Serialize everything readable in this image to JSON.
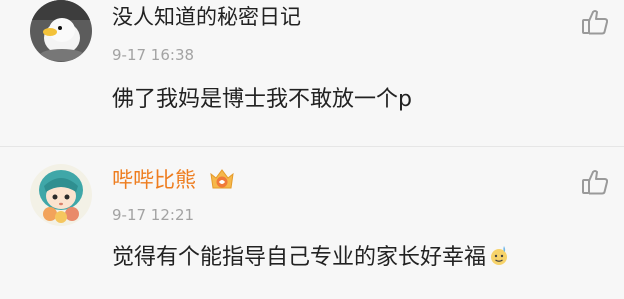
{
  "comments": [
    {
      "username": "没人知道的秘密日记",
      "timestamp": "9-17 16:38",
      "content": "佛了我妈是博士我不敢放一个p",
      "avatar_icon": "duck-avatar-icon"
    },
    {
      "username": "哔哔比熊",
      "timestamp": "9-17 12:21",
      "content": "觉得有个能指导自己专业的家长好幸福",
      "avatar_icon": "girl-avatar-icon",
      "badge_icon": "crown-vip-icon",
      "emoji": "sweat-smile-emoji-icon"
    }
  ],
  "colors": {
    "background": "#f7f7f7",
    "text": "#222222",
    "timestamp": "#a3a3a3",
    "vip_username": "#ee7d1f",
    "like_icon": "#9a9a9a"
  }
}
